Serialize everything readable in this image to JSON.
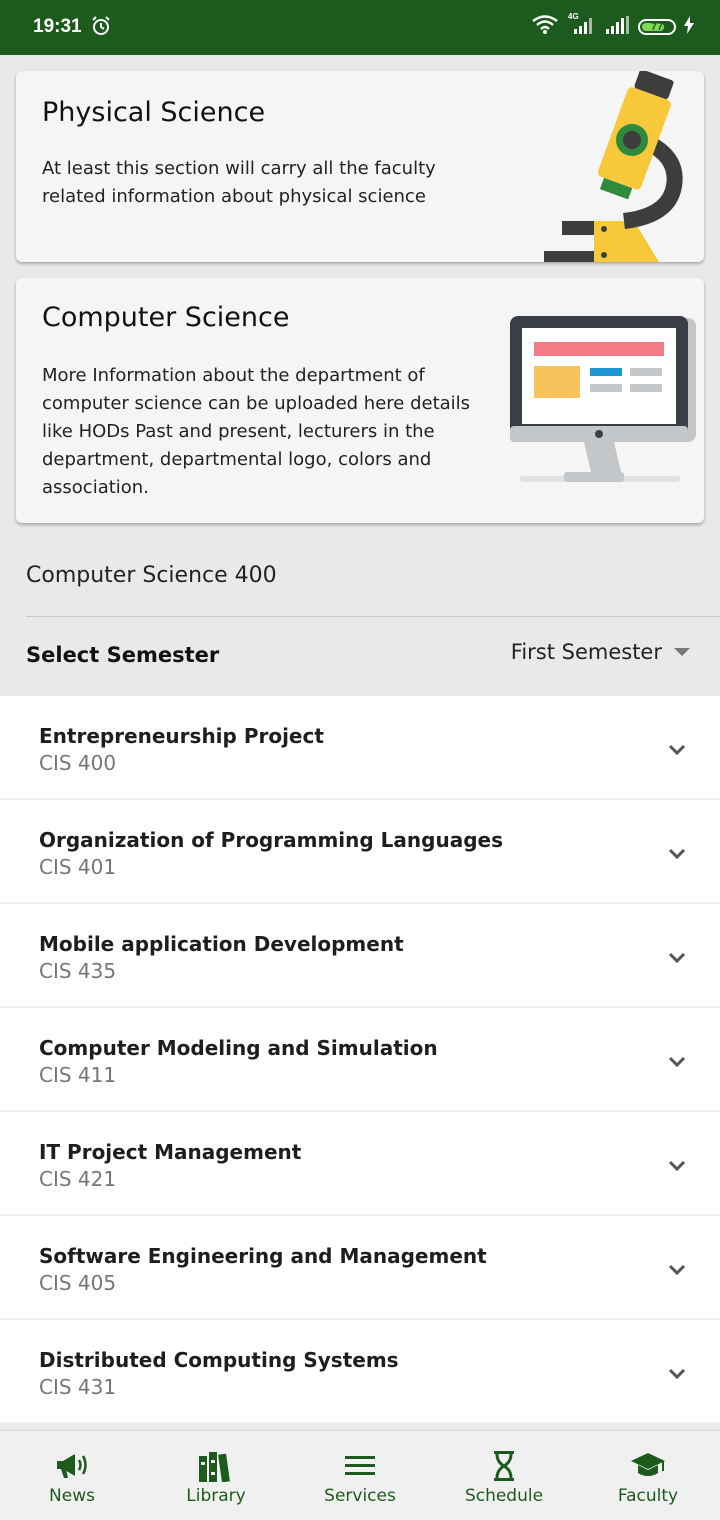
{
  "status_bar": {
    "time": "19:31",
    "network": "4G",
    "battery": "77",
    "battery_level": 0.77
  },
  "cards": [
    {
      "title": "Physical Science",
      "body": "At least this section will carry all the faculty related information about physical science"
    },
    {
      "title": "Computer Science",
      "body": "More Information about the department of computer science can be uploaded here details like HODs Past and present, lecturers in the department, departmental logo, colors and association."
    }
  ],
  "class_title": "Computer Science 400",
  "semester": {
    "label": "Select Semester",
    "selected": "First Semester"
  },
  "courses": [
    {
      "name": "Entrepreneurship Project",
      "code": "CIS 400"
    },
    {
      "name": "Organization of Programming Languages",
      "code": "CIS 401"
    },
    {
      "name": "Mobile application Development",
      "code": "CIS 435"
    },
    {
      "name": "Computer Modeling and Simulation",
      "code": "CIS 411"
    },
    {
      "name": "IT Project Management",
      "code": "CIS 421"
    },
    {
      "name": "Software Engineering and Management",
      "code": "CIS 405"
    },
    {
      "name": "Distributed Computing Systems",
      "code": "CIS 431"
    }
  ],
  "nav": [
    {
      "label": "News",
      "icon": "megaphone-icon"
    },
    {
      "label": "Library",
      "icon": "books-icon"
    },
    {
      "label": "Services",
      "icon": "menu-icon"
    },
    {
      "label": "Schedule",
      "icon": "hourglass-icon"
    },
    {
      "label": "Faculty",
      "icon": "graduation-cap-icon"
    }
  ],
  "colors": {
    "primary": "#1c5a1d",
    "background": "#e8e9eb",
    "card": "#f5f5f5"
  }
}
